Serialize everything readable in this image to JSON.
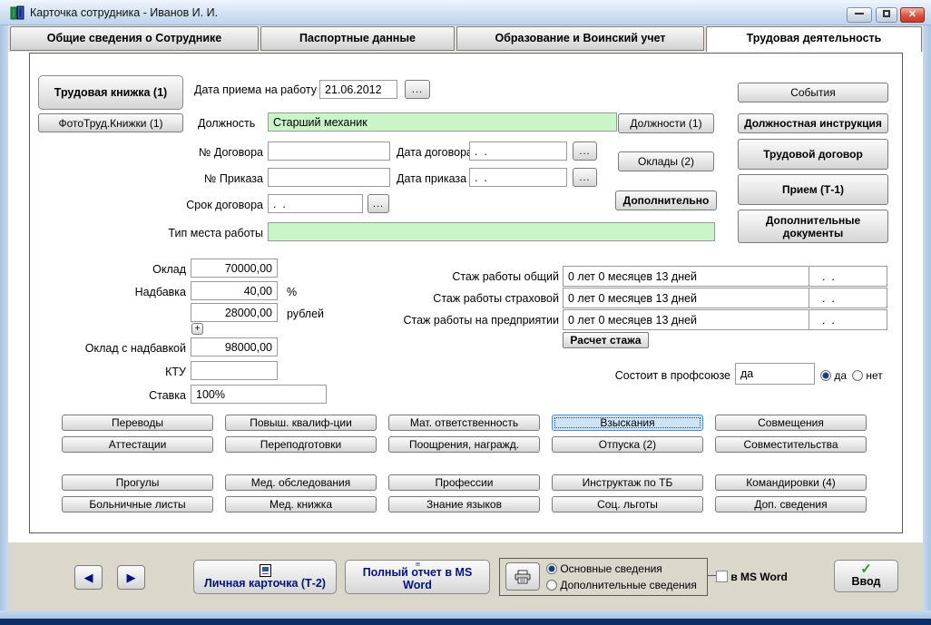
{
  "window": {
    "title": "Карточка сотрудника -  Иванов И. И."
  },
  "tabs": [
    {
      "label": "Общие сведения о Сотруднике",
      "active": false
    },
    {
      "label": "Паспортные данные",
      "active": false
    },
    {
      "label": "Образование и Воинский учет",
      "active": false
    },
    {
      "label": "Трудовая деятельность",
      "active": true
    }
  ],
  "header_buttons": {
    "work_book": "Трудовая книжка (1)",
    "photo_book": "ФотоТруд.Книжки (1)"
  },
  "fields": {
    "ellipsis": "...",
    "hire_date": {
      "label": "Дата приема на работу",
      "value": "21.06.2012"
    },
    "position": {
      "label": "Должность",
      "value": "Старший механик"
    },
    "contract_no": {
      "label": "№ Договора",
      "value": ""
    },
    "contract_date": {
      "label": "Дата договора",
      "value": ".  ."
    },
    "order_no": {
      "label": "№ Приказа",
      "value": ""
    },
    "order_date": {
      "label": "Дата приказа",
      "value": ".  ."
    },
    "contract_term": {
      "label": "Срок договора",
      "value": ".  ."
    },
    "workplace_type": {
      "label": "Тип места работы",
      "value": ""
    }
  },
  "side_buttons": {
    "positions": "Должности (1)",
    "salaries": "Оклады (2)",
    "additional": "Дополнительно"
  },
  "right_buttons": {
    "events": "События",
    "job_description": "Должностная инструкция",
    "labor_contract": "Трудовой  договор",
    "hiring": "Прием (Т-1)",
    "additional_documents": "Дополнительные документы"
  },
  "salary": {
    "base": {
      "label": "Оклад",
      "value": "70000,00"
    },
    "bonus_percent": {
      "label": "Надбавка",
      "value": "40,00",
      "unit": "%"
    },
    "bonus_rub": {
      "value": "28000,00",
      "unit": "рублей"
    },
    "plus_button": "+",
    "total": {
      "label": "Оклад с надбавкой",
      "value": "98000,00"
    },
    "ktu": {
      "label": "КТУ",
      "value": ""
    },
    "rate": {
      "label": "Ставка",
      "value": "100%"
    }
  },
  "experience": {
    "rows": [
      {
        "label": "Стаж работы общий",
        "value": "0 лет 0 месяцев 13 дней",
        "date": ".  ."
      },
      {
        "label": "Стаж работы страховой",
        "value": "0 лет 0 месяцев 13 дней",
        "date": ".  ."
      },
      {
        "label": "Стаж работы на предприятии",
        "value": "0 лет 0 месяцев 13 дней",
        "date": ".  ."
      }
    ],
    "calc_button": "Расчет стажа"
  },
  "union": {
    "label": "Состоит в профсоюзе",
    "value": "да",
    "yes": "да",
    "no": "нет"
  },
  "grid": {
    "rows": [
      [
        "Переводы",
        "Повыш. квалиф-ции",
        "Мат. ответственность",
        "Взыскания",
        "Совмещения"
      ],
      [
        "Аттестации",
        "Переподготовки",
        "Поощрения, награжд.",
        "Отпуска (2)",
        "Совместительства"
      ],
      [
        "Прогулы",
        "Мед. обследования",
        "Профессии",
        "Инструктаж по ТБ",
        "Командировки (4)"
      ],
      [
        "Больничные листы",
        "Мед. книжка",
        "Знание языков",
        "Соц. льготы",
        "Доп. сведения"
      ]
    ]
  },
  "bottom": {
    "personal_card": "Личная карточка (Т-2)",
    "full_report": "Полный отчет в MS Word",
    "print_main": "Основные сведения",
    "print_additional": "Дополнительные сведения",
    "msword_checkbox": "в MS Word",
    "enter_button": "Ввод"
  },
  "colors": {
    "green_field": "#c9f5c9",
    "focused_button": "#cfe3f6",
    "link_text": "#00127f",
    "check_green": "#1f9b1f"
  }
}
